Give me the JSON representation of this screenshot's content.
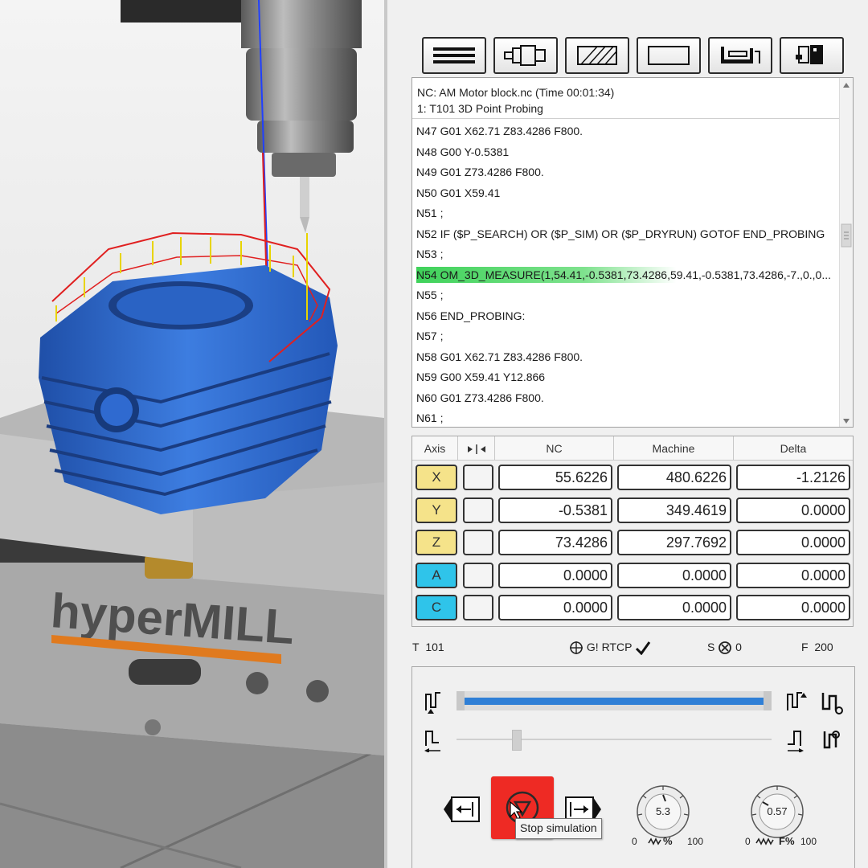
{
  "viewport": {
    "watermark_brand": "hyperMILL"
  },
  "toolbar": {
    "buttons": [
      {
        "icon": "nc-lines-icon"
      },
      {
        "icon": "tool-holder-icon"
      },
      {
        "icon": "stock-hatch-icon"
      },
      {
        "icon": "blank-view-icon"
      },
      {
        "icon": "machine-fixture-icon"
      },
      {
        "icon": "machine-icon"
      }
    ]
  },
  "nc": {
    "file_line": "NC: AM Motor block.nc (Time 00:01:34)",
    "job_line": "1: T101 3D Point Probing",
    "lines": [
      "N47 G01 X62.71 Z83.4286 F800.",
      "N48 G00 Y-0.5381",
      "N49 G01 Z73.4286 F800.",
      "N50 G01 X59.41",
      "N51 ;",
      "N52 IF ($P_SEARCH) OR ($P_SIM) OR ($P_DRYRUN) GOTOF END_PROBING",
      "N53 ;",
      "N54 OM_3D_MEASURE(1,54.41,-0.5381,73.4286,59.41,-0.5381,73.4286,-7.,0.,0...",
      "N55 ;",
      "N56 END_PROBING:",
      "N57 ;",
      "N58 G01 X62.71 Z83.4286 F800.",
      "N59 G00 X59.41 Y12.866",
      "N60 G01 Z73.4286 F800.",
      "N61 ;"
    ],
    "highlighted_index": 7
  },
  "axes": {
    "headers": {
      "axis": "Axis",
      "nc": "NC",
      "machine": "Machine",
      "delta": "Delta"
    },
    "rows": [
      {
        "name": "X",
        "nc": "55.6226",
        "machine": "480.6226",
        "delta": "-1.2126",
        "color": "#f5e38a"
      },
      {
        "name": "Y",
        "nc": "-0.5381",
        "machine": "349.4619",
        "delta": "0.0000",
        "color": "#f5e38a"
      },
      {
        "name": "Z",
        "nc": "73.4286",
        "machine": "297.7692",
        "delta": "0.0000",
        "color": "#f5e38a"
      },
      {
        "name": "A",
        "nc": "0.0000",
        "machine": "0.0000",
        "delta": "0.0000",
        "color": "#2fc4ea"
      },
      {
        "name": "C",
        "nc": "0.0000",
        "machine": "0.0000",
        "delta": "0.0000",
        "color": "#2fc4ea"
      }
    ]
  },
  "status": {
    "tool_label": "T",
    "tool_value": "101",
    "g_label": "G!",
    "rtcp_label": "RTCP",
    "spindle_label": "S",
    "spindle_value": "0",
    "feed_label": "F",
    "feed_value": "200"
  },
  "controls": {
    "progress_fraction": 1.0,
    "step_fraction": 0.18,
    "stop_tooltip": "Stop simulation",
    "speed_dial": {
      "value": "5.3",
      "min": "0",
      "max": "100",
      "unit": "%"
    },
    "feed_dial": {
      "value": "0.57",
      "min": "0",
      "max": "100",
      "unit": "F%"
    }
  }
}
